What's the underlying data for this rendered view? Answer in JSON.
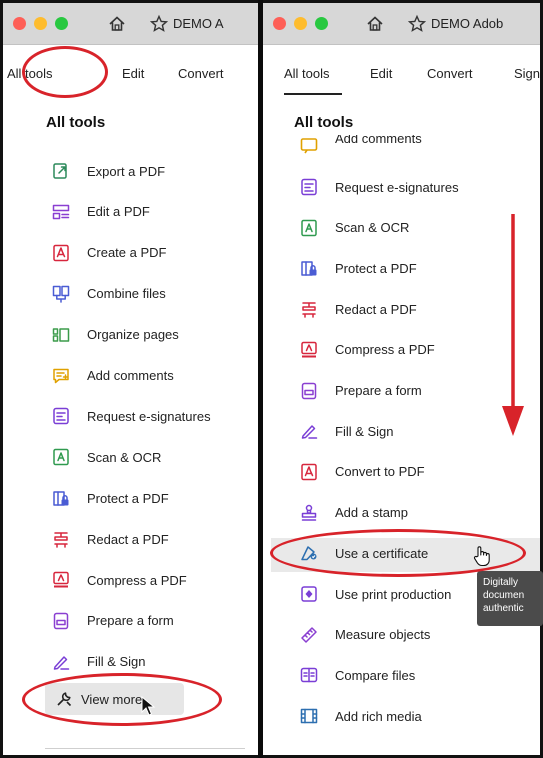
{
  "left": {
    "tab_title": "DEMO A",
    "menu": [
      "All tools",
      "Edit",
      "Convert"
    ],
    "section_title": "All tools",
    "tools": [
      {
        "label": "Export a PDF",
        "icon": "export-pdf-icon",
        "color": "#2d8a5b"
      },
      {
        "label": "Edit a PDF",
        "icon": "edit-pdf-icon",
        "color": "#8a3fd1"
      },
      {
        "label": "Create a PDF",
        "icon": "create-pdf-icon",
        "color": "#d7263d"
      },
      {
        "label": "Combine files",
        "icon": "combine-files-icon",
        "color": "#4a5cd4"
      },
      {
        "label": "Organize pages",
        "icon": "organize-pages-icon",
        "color": "#3b9b4a"
      },
      {
        "label": "Add comments",
        "icon": "add-comments-icon",
        "color": "#e0a100"
      },
      {
        "label": "Request e-signatures",
        "icon": "request-esign-icon",
        "color": "#7a3ed6"
      },
      {
        "label": "Scan & OCR",
        "icon": "scan-ocr-icon",
        "color": "#2f9a4f"
      },
      {
        "label": "Protect a PDF",
        "icon": "protect-pdf-icon",
        "color": "#4a5cd4"
      },
      {
        "label": "Redact a PDF",
        "icon": "redact-pdf-icon",
        "color": "#d7263d"
      },
      {
        "label": "Compress a PDF",
        "icon": "compress-pdf-icon",
        "color": "#d7263d"
      },
      {
        "label": "Prepare a form",
        "icon": "prepare-form-icon",
        "color": "#8a3fd1"
      },
      {
        "label": "Fill & Sign",
        "icon": "fill-sign-icon",
        "color": "#7a3ed6"
      }
    ],
    "view_more": "View more"
  },
  "right": {
    "tab_title": "DEMO Adob",
    "menu": [
      "All tools",
      "Edit",
      "Convert",
      "Sign"
    ],
    "section_title": "All tools",
    "partial_top_label": "Add comments",
    "tools": [
      {
        "label": "Request e-signatures",
        "icon": "request-esign-icon",
        "color": "#7a3ed6"
      },
      {
        "label": "Scan & OCR",
        "icon": "scan-ocr-icon",
        "color": "#2f9a4f"
      },
      {
        "label": "Protect a PDF",
        "icon": "protect-pdf-icon",
        "color": "#4a5cd4"
      },
      {
        "label": "Redact a PDF",
        "icon": "redact-pdf-icon",
        "color": "#d7263d"
      },
      {
        "label": "Compress a PDF",
        "icon": "compress-pdf-icon",
        "color": "#d7263d"
      },
      {
        "label": "Prepare a form",
        "icon": "prepare-form-icon",
        "color": "#8a3fd1"
      },
      {
        "label": "Fill & Sign",
        "icon": "fill-sign-icon",
        "color": "#7a3ed6"
      },
      {
        "label": "Convert to PDF",
        "icon": "convert-to-pdf-icon",
        "color": "#d7263d"
      },
      {
        "label": "Add a stamp",
        "icon": "add-stamp-icon",
        "color": "#7a3ed6"
      },
      {
        "label": "Use a certificate",
        "icon": "certificate-icon",
        "color": "#2d6fb0"
      },
      {
        "label": "Use print production",
        "icon": "print-production-icon",
        "color": "#7a3ed6"
      },
      {
        "label": "Measure objects",
        "icon": "measure-icon",
        "color": "#8a3fd1"
      },
      {
        "label": "Compare files",
        "icon": "compare-files-icon",
        "color": "#7a3ed6"
      },
      {
        "label": "Add rich media",
        "icon": "rich-media-icon",
        "color": "#2d6fb0"
      }
    ],
    "tooltip_lines": [
      "Digitally",
      "documen",
      "authentic"
    ]
  },
  "colors": {
    "annotation_red": "#d8232a",
    "titlebar_gray": "#d7d7d7"
  }
}
